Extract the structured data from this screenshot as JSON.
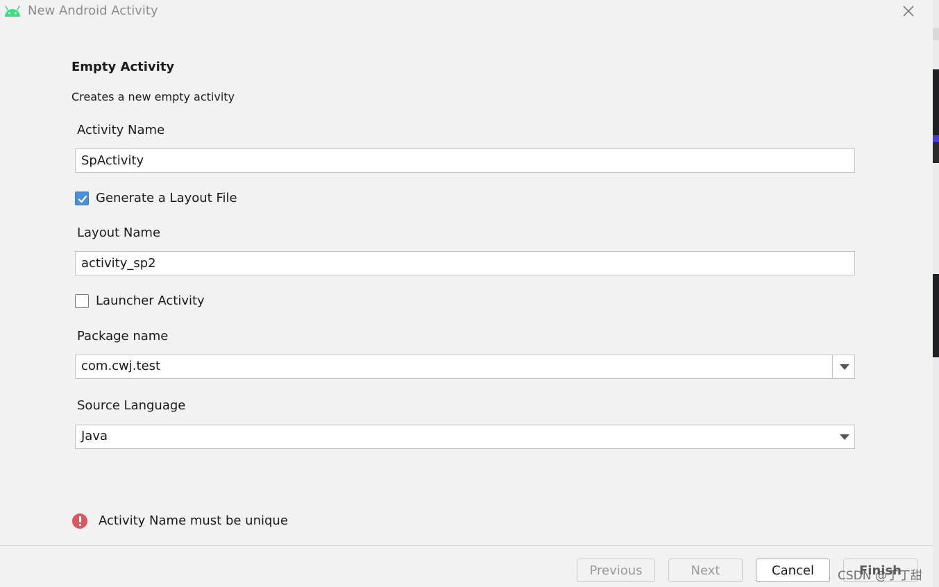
{
  "window": {
    "title": "New Android Activity",
    "icon": "android-icon",
    "close_icon": "close-icon"
  },
  "template": {
    "heading": "Empty Activity",
    "description": "Creates a new empty activity"
  },
  "form": {
    "activity_name_label": "Activity Name",
    "activity_name_value": "SpActivity",
    "generate_layout_label": "Generate a Layout File",
    "generate_layout_checked": true,
    "layout_name_label": "Layout Name",
    "layout_name_value": "activity_sp2",
    "launcher_label": "Launcher Activity",
    "launcher_checked": false,
    "package_name_label": "Package name",
    "package_name_value": "com.cwj.test",
    "source_language_label": "Source Language",
    "source_language_value": "Java"
  },
  "validation": {
    "icon": "error-icon",
    "message": "Activity Name must be unique"
  },
  "buttons": {
    "previous": "Previous",
    "next": "Next",
    "cancel": "Cancel",
    "finish": "Finish"
  },
  "watermark": "CSDN @丁丁甜",
  "colors": {
    "android_green": "#3ddc84",
    "checkbox_blue": "#4a90d9",
    "error_red": "#db5860"
  }
}
